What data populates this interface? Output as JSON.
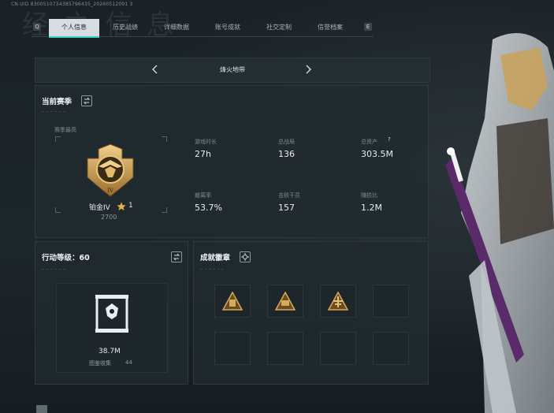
{
  "uid_text": "CN UID 8300510734385796435_20260512091 3",
  "background_title": "经 之 信 息",
  "tabs": {
    "left_key": "Q",
    "right_key": "E",
    "items": [
      {
        "label": "个人信息",
        "active": true
      },
      {
        "label": "历史战绩",
        "active": false
      },
      {
        "label": "详细数据",
        "active": false
      },
      {
        "label": "账号成就",
        "active": false
      },
      {
        "label": "社交定制",
        "active": false
      },
      {
        "label": "信誉档案",
        "active": false
      }
    ]
  },
  "mode": {
    "title": "烽火地带"
  },
  "season": {
    "title": "当前赛季",
    "best_label": "赛季最高",
    "rank_name": "铂金IV",
    "rank_stars": "1",
    "rank_points": "2700",
    "stats": [
      {
        "label": "游戏时长",
        "value": "27h"
      },
      {
        "label": "总战局",
        "value": "136"
      },
      {
        "label": "总资产",
        "value": "303.5M",
        "help": "?"
      },
      {
        "label": "撤离率",
        "value": "53.7%"
      },
      {
        "label": "击败干员",
        "value": "157"
      },
      {
        "label": "赚损比",
        "value": "1.2M"
      }
    ]
  },
  "action_level": {
    "title": "行动等级：60",
    "value": "38.7M",
    "collection_label": "图鉴收集",
    "collection_value": "44"
  },
  "achievements": {
    "title": "成就徽章",
    "badges": [
      {
        "filled": true
      },
      {
        "filled": true
      },
      {
        "filled": true
      },
      {
        "filled": false
      },
      {
        "filled": false
      },
      {
        "filled": false
      },
      {
        "filled": false
      },
      {
        "filled": false
      }
    ]
  },
  "colors": {
    "accent": "#3ad1c5",
    "gold": "#c9a25a",
    "panel": "#202a2f"
  },
  "icons": [
    "chevron-left-icon",
    "chevron-right-icon",
    "swap-icon",
    "settings-icon",
    "star-icon",
    "rank-emblem-icon",
    "pyramid-badge-icon",
    "collection-case-icon"
  ]
}
